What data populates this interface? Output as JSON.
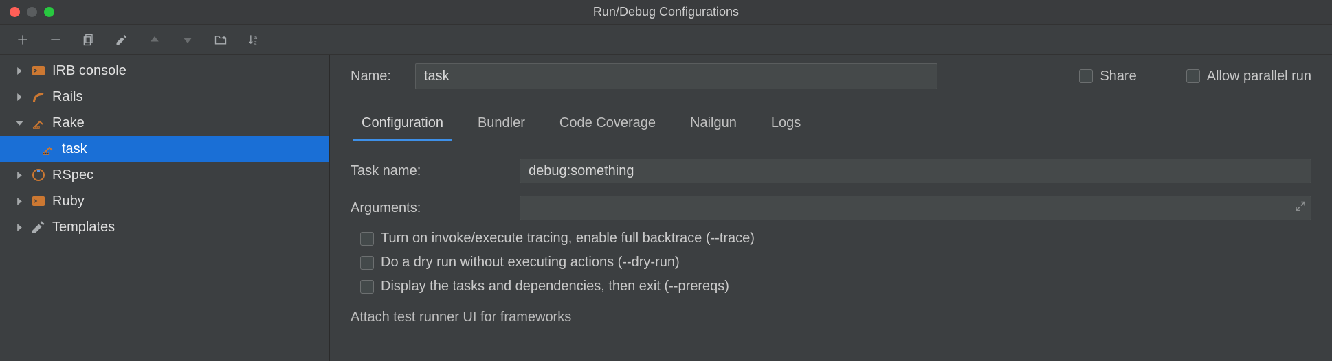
{
  "window": {
    "title": "Run/Debug Configurations"
  },
  "tree": {
    "items": [
      {
        "label": "IRB console",
        "icon": "irb",
        "expanded": false,
        "children": []
      },
      {
        "label": "Rails",
        "icon": "rails",
        "expanded": false,
        "children": []
      },
      {
        "label": "Rake",
        "icon": "rake",
        "expanded": true,
        "children": [
          {
            "label": "task",
            "icon": "rake",
            "selected": true
          }
        ]
      },
      {
        "label": "RSpec",
        "icon": "rspec",
        "expanded": false,
        "children": []
      },
      {
        "label": "Ruby",
        "icon": "ruby",
        "expanded": false,
        "children": []
      },
      {
        "label": "Templates",
        "icon": "wrench",
        "expanded": false,
        "children": []
      }
    ]
  },
  "name_field": {
    "label": "Name:",
    "value": "task"
  },
  "options": {
    "share_label": "Share",
    "share_checked": false,
    "parallel_label": "Allow parallel run",
    "parallel_checked": false
  },
  "tabs": [
    {
      "label": "Configuration",
      "active": true
    },
    {
      "label": "Bundler"
    },
    {
      "label": "Code Coverage"
    },
    {
      "label": "Nailgun"
    },
    {
      "label": "Logs"
    }
  ],
  "config": {
    "task_name_label": "Task name:",
    "task_name_value": "debug:something",
    "arguments_label": "Arguments:",
    "arguments_value": "",
    "checks": [
      {
        "label": "Turn on invoke/execute tracing, enable full backtrace (--trace)",
        "checked": false
      },
      {
        "label": "Do a dry run without executing actions (--dry-run)",
        "checked": false
      },
      {
        "label": "Display the tasks and dependencies, then exit (--prereqs)",
        "checked": false
      }
    ],
    "attach_label": "Attach test runner UI for frameworks"
  }
}
